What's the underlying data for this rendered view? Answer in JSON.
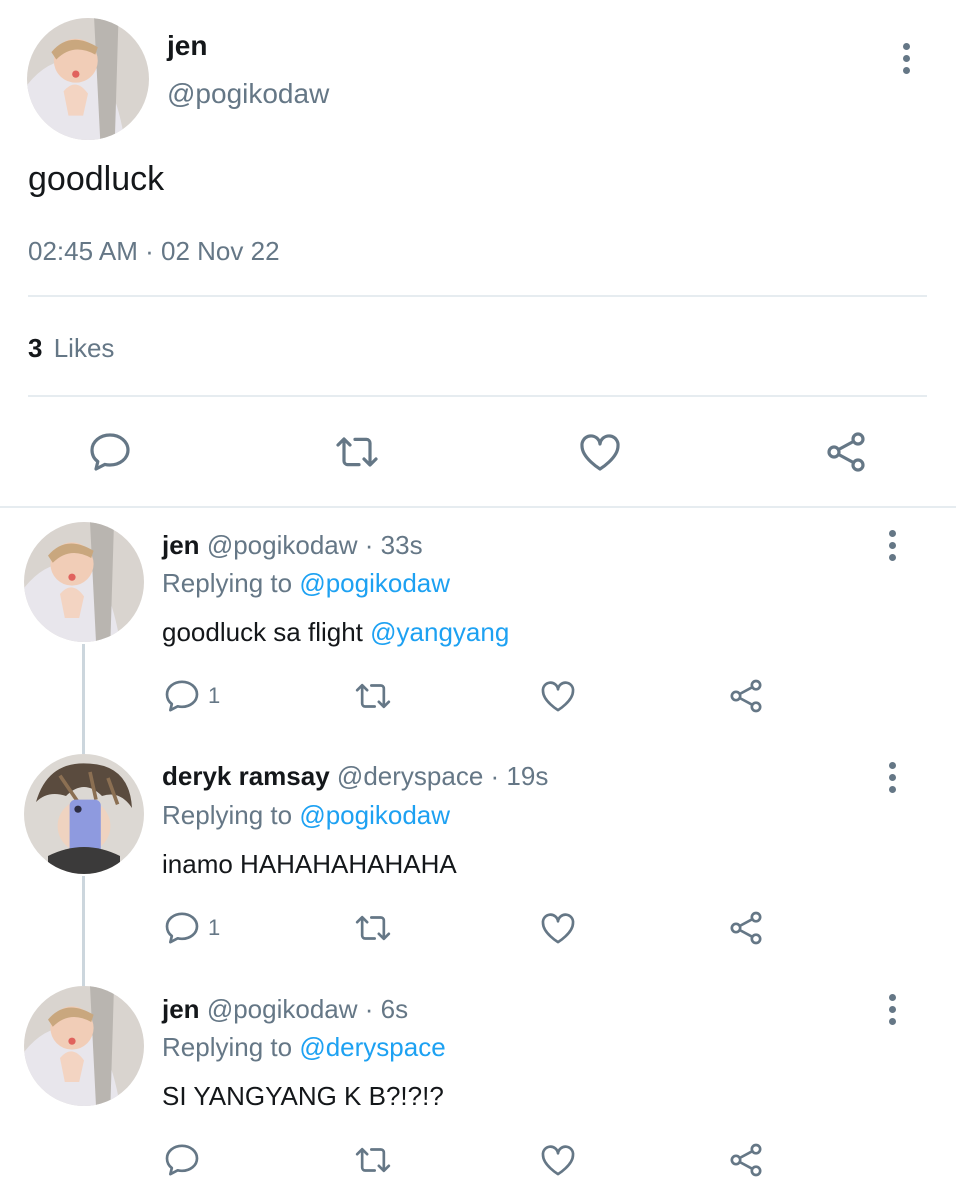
{
  "main_tweet": {
    "display_name": "jen",
    "handle": "@pogikodaw",
    "text": "goodluck",
    "time": "02:45 AM",
    "separator": "·",
    "date": "02 Nov 22",
    "likes_count": "3",
    "likes_label": "Likes"
  },
  "replies": [
    {
      "display_name": "jen",
      "handle": "@pogikodaw",
      "age": "33s",
      "replying_label": "Replying to",
      "replying_to": "@pogikodaw",
      "text": "goodluck sa flight",
      "mention": "@yangyang",
      "reply_count": "1"
    },
    {
      "display_name": "deryk ramsay",
      "handle": "@deryspace",
      "age": "19s",
      "replying_label": "Replying to",
      "replying_to": "@pogikodaw",
      "text": "inamo HAHAHAHAHAHA",
      "reply_count": "1"
    },
    {
      "display_name": "jen",
      "handle": "@pogikodaw",
      "age": "6s",
      "replying_label": "Replying to",
      "replying_to": "@deryspace",
      "text": "SI YANGYANG K B?!?!?"
    }
  ],
  "icons": {
    "reply": "reply-icon",
    "retweet": "retweet-icon",
    "like": "heart-icon",
    "share": "share-icon",
    "more": "more-vertical-icon"
  },
  "colors": {
    "text": "#14171a",
    "muted": "#657786",
    "link": "#1da1f2",
    "divider": "#e6ecf0"
  }
}
